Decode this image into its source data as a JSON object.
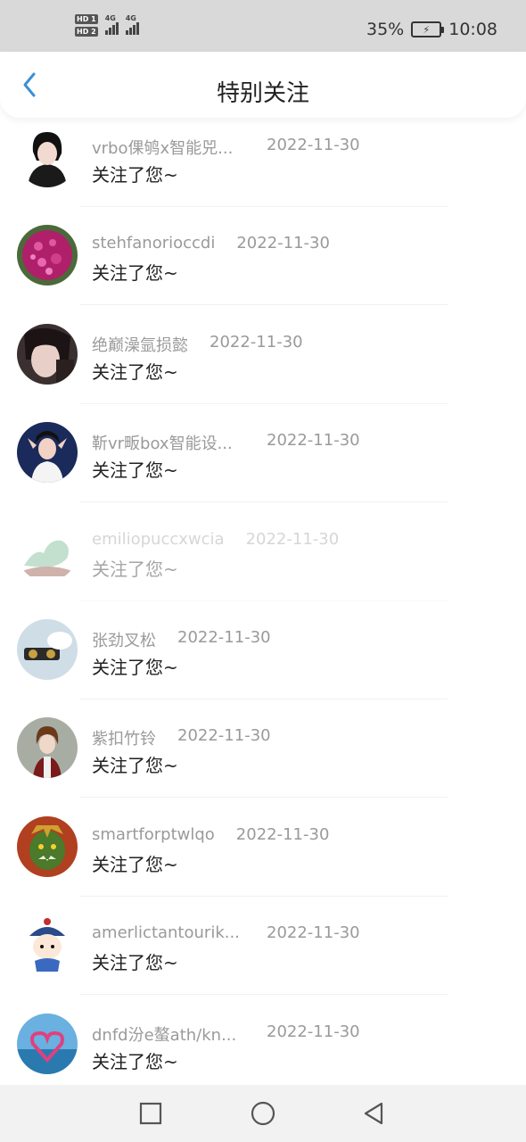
{
  "status_bar": {
    "sim1": "HD 1",
    "sim2": "HD 2",
    "network1": "4G",
    "network2": "4G",
    "battery": "35%",
    "time": "10:08"
  },
  "header": {
    "back_icon": "chevron-left-icon",
    "title": "特别关注"
  },
  "list": [
    {
      "name": "vrbo倮鸲x智能兕...",
      "date": "2022-11-30",
      "action": "关注了您~",
      "avatar": "anime-boy-avatar"
    },
    {
      "name": "stehfanorioccdi",
      "date": "2022-11-30",
      "action": "关注了您~",
      "avatar": "purple-flower-avatar"
    },
    {
      "name": "绝巅澡氩损懿",
      "date": "2022-11-30",
      "action": "关注了您~",
      "avatar": "dark-hair-girl-avatar"
    },
    {
      "name": "靳vr畈box智能设...",
      "date": "2022-11-30",
      "action": "关注了您~",
      "avatar": "girl-peace-sign-avatar"
    },
    {
      "name": "emiliopuccxwcia",
      "date": "2022-11-30",
      "action": "关注了您~",
      "avatar": "jade-sculpture-avatar",
      "faded": true
    },
    {
      "name": "张劲叉松",
      "date": "2022-11-30",
      "action": "关注了您~",
      "avatar": "toy-glasses-avatar"
    },
    {
      "name": "紫扣竹铃",
      "date": "2022-11-30",
      "action": "关注了您~",
      "avatar": "anime-man-avatar"
    },
    {
      "name": "smartforptwlqo",
      "date": "2022-11-30",
      "action": "关注了您~",
      "avatar": "orc-warrior-avatar"
    },
    {
      "name": "amerlictantourik...",
      "date": "2022-11-30",
      "action": "关注了您~",
      "avatar": "qing-cartoon-avatar"
    },
    {
      "name": "dnfd汾e螯ath/kn...",
      "date": "2022-11-30",
      "action": "关注了您~",
      "avatar": "heart-beach-avatar"
    }
  ],
  "nav_bar": {
    "recent": "square-icon",
    "home": "circle-icon",
    "back": "triangle-back-icon"
  },
  "colors": {
    "accent": "#3b8fd6",
    "status_bar_bg": "#d9d9d9",
    "name_text": "#9a9a9a",
    "action_text": "#222222",
    "nav_bar_bg": "#f2f2f2"
  }
}
